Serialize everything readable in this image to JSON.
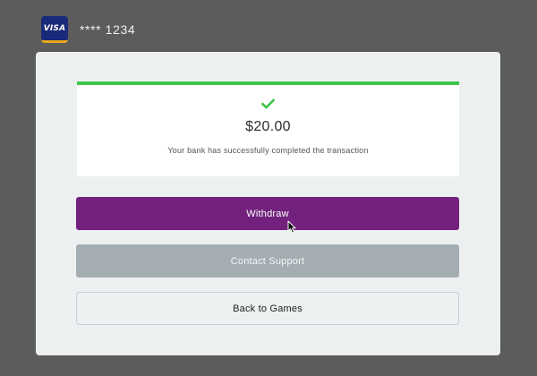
{
  "card": {
    "brand_label": "VISA",
    "brand_icon": "visa-card-icon",
    "masked_number": "**** 1234"
  },
  "result": {
    "status_icon": "check-icon",
    "amount": "$20.00",
    "message": "Your bank has successfully completed the transaction"
  },
  "actions": {
    "withdraw_label": "Withdraw",
    "contact_support_label": "Contact Support",
    "back_to_games_label": "Back to Games"
  },
  "colors": {
    "background": "#5c5c5c",
    "panel": "#ecf0f1",
    "success_accent": "#3fc54a",
    "primary_button": "#72217d",
    "secondary_button": "#a4adb2",
    "visa_blue": "#1a2a7a",
    "visa_gold": "#e8a81c"
  }
}
